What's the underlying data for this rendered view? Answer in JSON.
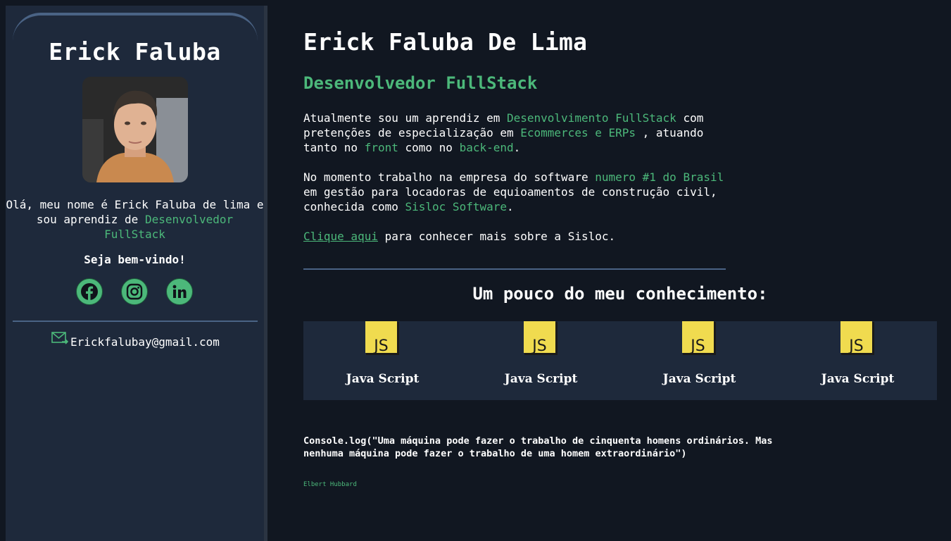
{
  "sidebar": {
    "name": "Erick Faluba",
    "intro_prefix": "Olá, meu nome é Erick Faluba de lima e sou aprendiz de ",
    "intro_highlight": "Desenvolvedor FullStack",
    "welcome": "Seja bem-vindo!",
    "social": [
      {
        "name": "facebook",
        "icon": "facebook-icon"
      },
      {
        "name": "instagram",
        "icon": "instagram-icon"
      },
      {
        "name": "linkedin",
        "icon": "linkedin-icon"
      }
    ],
    "email": "Erickfalubay@gmail.com"
  },
  "main": {
    "title": "Erick Faluba De Lima",
    "subtitle": "Desenvolvedor FullStack",
    "p1": {
      "t1": "Atualmente sou um aprendiz em ",
      "h1": "Desenvolvimento FullStack",
      "t2": " com pretenções de especialização em ",
      "h2": "Ecommerces e ERPs",
      "t3": " , atuando tanto no ",
      "h3": "front",
      "t4": " como no ",
      "h4": "back-end",
      "t5": "."
    },
    "p2": {
      "t1": "No momento trabalho na empresa do software ",
      "h1": "numero #1 do Brasil",
      "t2": " em gestão para locadoras de equioamentos de construção civil, conhecida como ",
      "h2": "Sisloc Software",
      "t3": "."
    },
    "p3": {
      "link": "Clique aqui",
      "text": " para conhecer mais sobre a Sisloc."
    },
    "skills_heading": "Um pouco do meu conhecimento:",
    "skills": [
      {
        "label": "Java Script",
        "icon_text": "JS"
      },
      {
        "label": "Java Script",
        "icon_text": "JS"
      },
      {
        "label": "Java Script",
        "icon_text": "JS"
      },
      {
        "label": "Java Script",
        "icon_text": "JS"
      }
    ],
    "quote": "Console.log(\"Uma máquina pode fazer o trabalho de cinquenta homens ordinários. Mas nenhuma máquina pode fazer o trabalho de uma homem extraordinário\")",
    "quote_author": "Elbert Hubbard"
  },
  "colors": {
    "background": "#111721",
    "panel": "#1e293b",
    "accent": "#4cb87a",
    "divider": "#4a6385",
    "js_yellow": "#f0db4f"
  }
}
